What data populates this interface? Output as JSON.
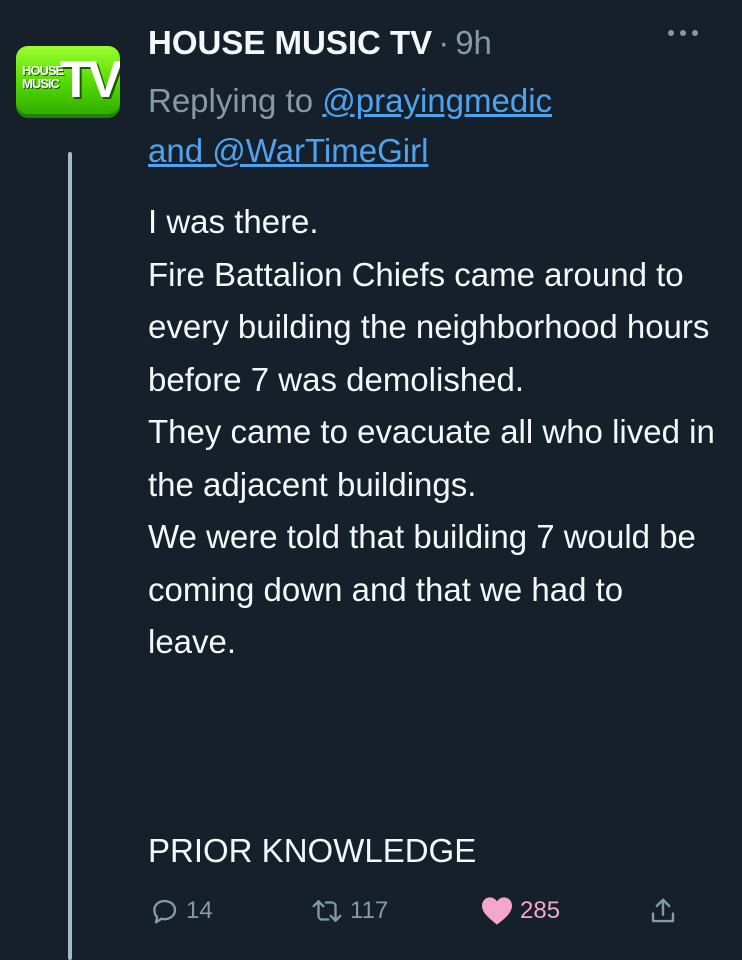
{
  "tweet": {
    "author_name": "HOUSE MUSIC TV",
    "separator": "·",
    "time": "9h",
    "avatar": {
      "small_text_line1": "HOUSE",
      "small_text_line2": "MUSIC",
      "big_text": "TV",
      "color": "#4fd600"
    },
    "replying_prefix": "Replying to ",
    "mention_1": "@prayingmedic",
    "replying_and": "and ",
    "mention_2": "@WarTimeGirl",
    "body_lines": [
      "I was there.",
      "Fire Battalion Chiefs came around to every building the neighborhood hours before 7 was demolished.",
      "They came to evacuate all who lived in the adjacent buildings.",
      "We were told that building 7 would be coming down and that we had to leave."
    ],
    "closing": "PRIOR KNOWLEDGE"
  },
  "actions": {
    "reply_count": "14",
    "retweet_count": "117",
    "like_count": "285",
    "like_color": "#f4a7c8"
  },
  "icons": {
    "reply": "reply-icon",
    "retweet": "retweet-icon",
    "like": "heart-icon",
    "share": "share-icon",
    "more": "more-icon"
  }
}
